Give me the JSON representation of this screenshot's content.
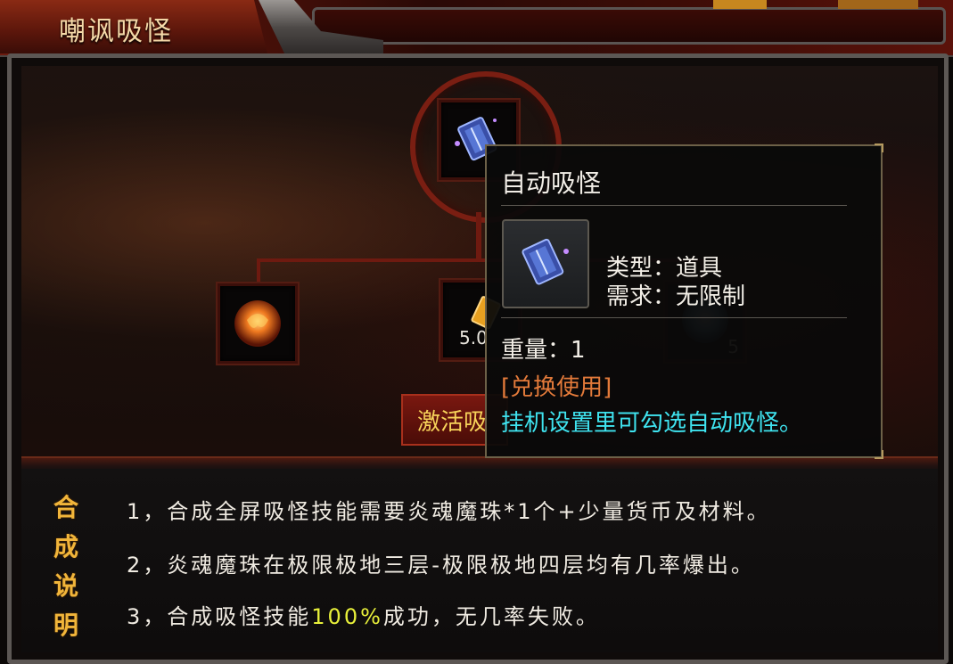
{
  "window": {
    "title": "嘲讽吸怪"
  },
  "recipe": {
    "left_item_icon": "flame-orb-icon",
    "mid_item_count": "5.0",
    "right_item_count": "5",
    "activate_label": "激活吸"
  },
  "tooltip": {
    "title": "自动吸怪",
    "type": "类型：道具",
    "requirement": "需求：无限制",
    "weight": "重量：1",
    "exchange": "[兑换使用]",
    "description": "挂机设置里可勾选自动吸怪。"
  },
  "description": {
    "label_chars": [
      "合",
      "成",
      "说",
      "明"
    ],
    "line1": "1，合成全屏吸怪技能需要炎魂魔珠*1个+少量货币及材料。",
    "line2": "2，炎魂魔珠在极限极地三层-极限极地四层均有几率爆出。",
    "line3_prefix": "3，合成吸怪技能",
    "line3_highlight": "100%",
    "line3_suffix": "成功，无几率失败。"
  },
  "colors": {
    "title": "#f4d9a8",
    "activate": "#f7d35a",
    "exchange": "#e37a3a",
    "desc_cyan": "#3fe3ef",
    "highlight": "#e8f03a",
    "label_gold": "#f1b53a"
  }
}
